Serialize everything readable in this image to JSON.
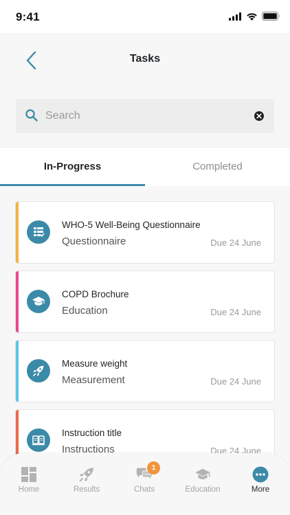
{
  "status_bar": {
    "time": "9:41"
  },
  "header": {
    "title": "Tasks"
  },
  "search": {
    "placeholder": "Search",
    "value": ""
  },
  "tabs": [
    {
      "label": "In-Progress",
      "active": true
    },
    {
      "label": "Completed",
      "active": false
    }
  ],
  "tasks": [
    {
      "title": "WHO-5 Well-Being Questionnaire",
      "category": "Questionnaire",
      "due": "Due 24 June",
      "accent": "#f2b442",
      "icon": "questionnaire-icon"
    },
    {
      "title": "COPD Brochure",
      "category": "Education",
      "due": "Due 24 June",
      "accent": "#e8478f",
      "icon": "graduation-cap-icon"
    },
    {
      "title": "Measure weight",
      "category": "Measurement",
      "due": "Due 24 June",
      "accent": "#58c6e8",
      "icon": "rocket-icon"
    },
    {
      "title": "Instruction title",
      "category": "Instructions",
      "due": "Due 24 June",
      "accent": "#ea6a4b",
      "icon": "book-icon"
    }
  ],
  "bottom_nav": [
    {
      "label": "Home",
      "icon": "home-grid-icon",
      "active": false
    },
    {
      "label": "Results",
      "icon": "rocket-icon",
      "active": false
    },
    {
      "label": "Chats",
      "icon": "chat-bubbles-icon",
      "active": false,
      "badge": "1"
    },
    {
      "label": "Education",
      "icon": "graduation-cap-icon",
      "active": false
    },
    {
      "label": "More",
      "icon": "more-dots-icon",
      "active": true
    }
  ],
  "colors": {
    "accent": "#3b8aa8",
    "badge": "#f0953b",
    "background": "#f7f7f7"
  }
}
